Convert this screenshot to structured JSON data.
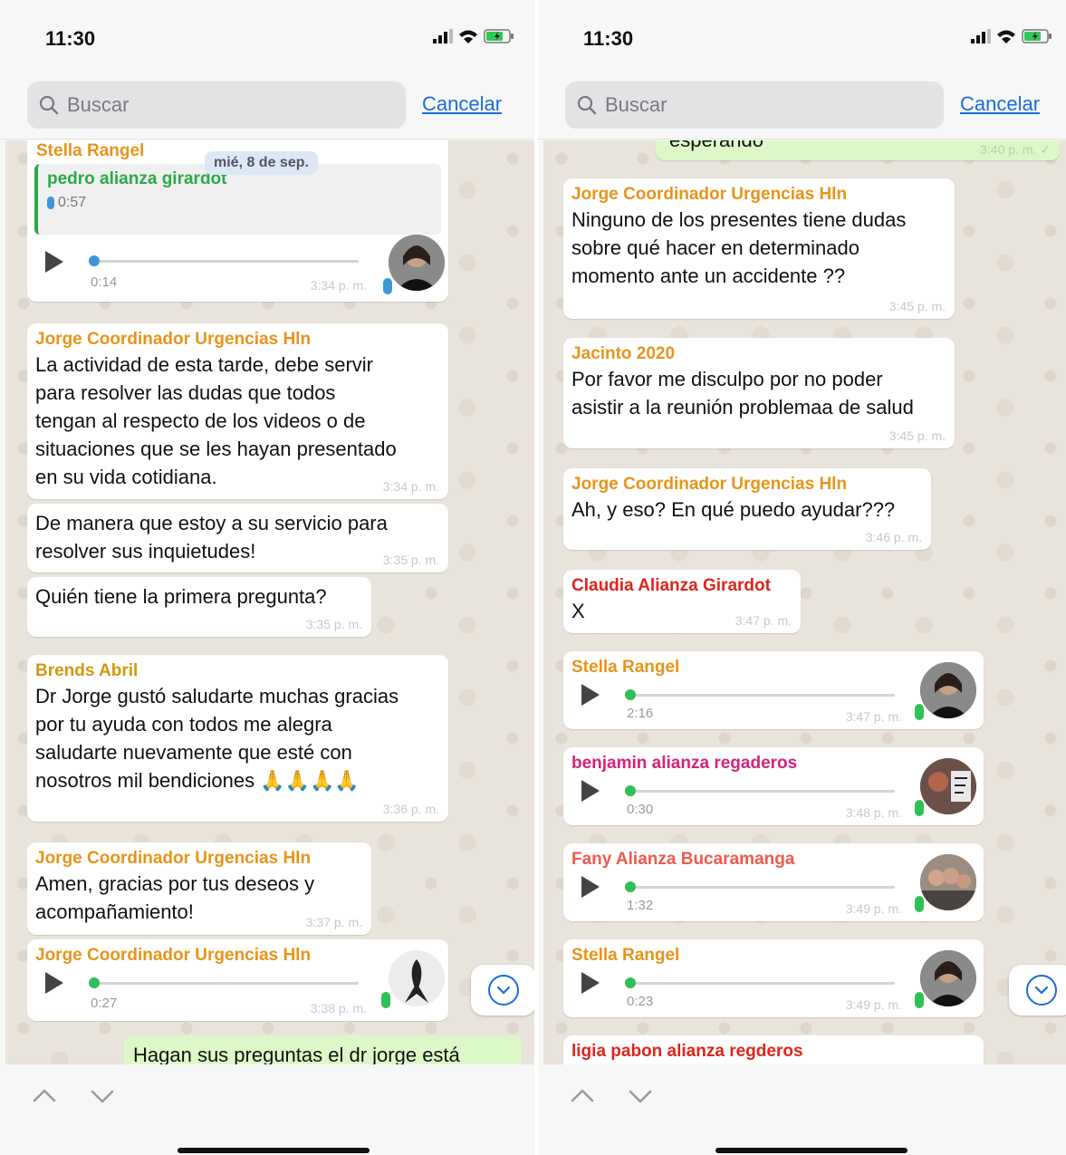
{
  "status": {
    "time": "11:30"
  },
  "search": {
    "placeholder": "Buscar",
    "cancel_label": "Cancelar"
  },
  "left": {
    "date_pill": "mié, 8 de sep.",
    "msg1": {
      "sender": "Stella Rangel",
      "quote_name": "pedro alianza girardot",
      "quote_duration": "0:57",
      "duration": "0:14",
      "time": "3:34 p. m."
    },
    "msg2": {
      "sender": "Jorge Coordinador Urgencias Hln",
      "lines": [
        "La actividad de esta tarde, debe servir",
        "para resolver las dudas que todos",
        "tengan al respecto de los videos o de",
        "situaciones que se les hayan presentado",
        "en su vida cotidiana."
      ],
      "time": "3:34 p. m."
    },
    "msg3": {
      "lines": [
        "De manera que estoy a su servicio para",
        "resolver sus inquietudes!"
      ],
      "time": "3:35 p. m."
    },
    "msg4": {
      "text": "Quién tiene la primera pregunta?",
      "time": "3:35 p. m."
    },
    "msg5": {
      "sender": "Brends Abril",
      "lines": [
        "Dr Jorge gustó saludarte muchas gracias",
        "por tu ayuda con todos me alegra",
        "saludarte nuevamente que esté con",
        "nosotros mil bendiciones 🙏🙏🙏🙏"
      ],
      "time": "3:36 p. m."
    },
    "msg6": {
      "sender": "Jorge Coordinador Urgencias Hln",
      "lines": [
        "Amen, gracias por tus deseos y",
        "acompañamiento!"
      ],
      "time": "3:37 p. m."
    },
    "msg7": {
      "sender": "Jorge Coordinador Urgencias Hln",
      "duration": "0:27",
      "time": "3:38 p. m."
    },
    "msg8": {
      "text": "Hagan sus preguntas el dr jorge está"
    }
  },
  "right": {
    "msg0": {
      "text": "esperando",
      "time": "3:40 p. m. ✓"
    },
    "msg1": {
      "sender": "Jorge Coordinador Urgencias Hln",
      "lines": [
        "Ninguno de los presentes tiene dudas",
        "sobre qué hacer en determinado",
        "momento ante un accidente ??"
      ],
      "time": "3:45 p. m."
    },
    "msg2": {
      "sender": "Jacinto 2020",
      "lines": [
        "Por favor me disculpo por no poder",
        "asistir a la reunión problemaa de salud"
      ],
      "time": "3:45 p. m."
    },
    "msg3": {
      "sender": "Jorge Coordinador Urgencias Hln",
      "text": "Ah, y eso? En qué puedo ayudar???",
      "time": "3:46 p. m."
    },
    "msg4": {
      "sender": "Claudia Alianza Girardot",
      "text": "X",
      "time": "3:47 p. m."
    },
    "msg5": {
      "sender": "Stella Rangel",
      "duration": "2:16",
      "time": "3:47 p. m."
    },
    "msg6": {
      "sender": "benjamin alianza regaderos",
      "duration": "0:30",
      "time": "3:48 p. m."
    },
    "msg7": {
      "sender": "Fany Alianza Bucaramanga",
      "duration": "1:32",
      "time": "3:49 p. m."
    },
    "msg8": {
      "sender": "Stella Rangel",
      "duration": "0:23",
      "time": "3:49 p. m."
    },
    "msg9": {
      "sender": "ligia pabon alianza regderos"
    }
  },
  "colors": {
    "orange": "#e8941a",
    "green": "#2ca84a",
    "red": "#e0241b",
    "pink": "#d4237a",
    "coral": "#ef5a4c",
    "link": "#1a6dd8",
    "out_bubble": "#dcf8c6"
  },
  "icons": [
    "search-icon",
    "play-icon",
    "mic-icon",
    "signal-icon",
    "wifi-icon",
    "battery-icon",
    "chevron-up-icon",
    "chevron-down-icon",
    "scroll-down-icon"
  ]
}
